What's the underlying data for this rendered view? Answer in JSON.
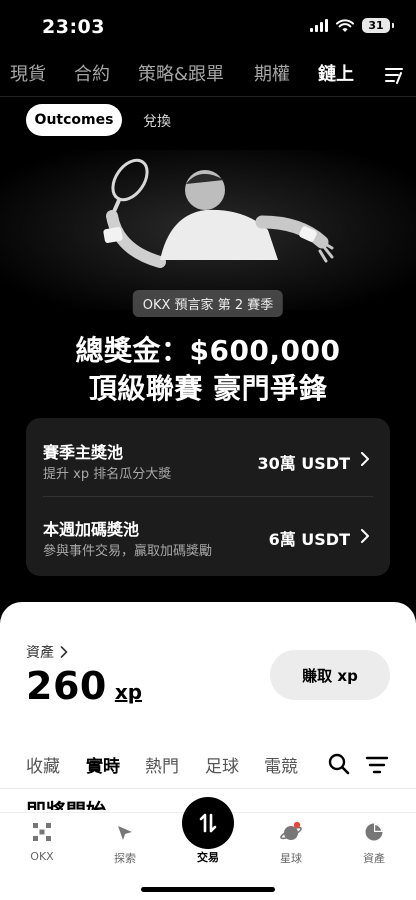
{
  "status_bar": {
    "time": "23:03",
    "battery": "31"
  },
  "top_tabs": [
    {
      "label": "現貨",
      "active": false
    },
    {
      "label": "合約",
      "active": false
    },
    {
      "label": "策略&跟單",
      "active": false
    },
    {
      "label": "期權",
      "active": false
    },
    {
      "label": "鏈上",
      "active": true
    }
  ],
  "sub_tabs": {
    "outcomes": "Outcomes",
    "exchange": "兌換"
  },
  "hero": {
    "season_badge": "OKX 預言家 第 2 賽季",
    "title_line1": "總獎金：$600,000",
    "title_line2": "頂級聯賽 豪門爭鋒"
  },
  "pools": [
    {
      "title": "賽季主獎池",
      "subtitle": "提升 xp 排名瓜分大獎",
      "amount": "30萬 USDT"
    },
    {
      "title": "本週加碼獎池",
      "subtitle": "參與事件交易，贏取加碼獎勵",
      "amount": "6萬 USDT"
    }
  ],
  "assets": {
    "label": "資產",
    "value": "260",
    "unit": "xp",
    "earn_button": "賺取 xp"
  },
  "category_tabs": [
    {
      "label": "收藏",
      "active": false
    },
    {
      "label": "實時",
      "active": true
    },
    {
      "label": "熱門",
      "active": false
    },
    {
      "label": "足球",
      "active": false
    },
    {
      "label": "電競",
      "active": false
    }
  ],
  "section_title": "即將開始",
  "bottom_nav": [
    {
      "label": "OKX",
      "icon": "okx-logo-icon"
    },
    {
      "label": "探索",
      "icon": "explore-icon"
    },
    {
      "label": "交易",
      "icon": "trade-icon",
      "active": true
    },
    {
      "label": "星球",
      "icon": "planet-icon"
    },
    {
      "label": "資產",
      "icon": "assets-pie-icon"
    }
  ],
  "colors": {
    "background": "#000000",
    "sheet": "#ffffff",
    "card": "#1c1c1c",
    "notification_dot": "#e5483c"
  }
}
